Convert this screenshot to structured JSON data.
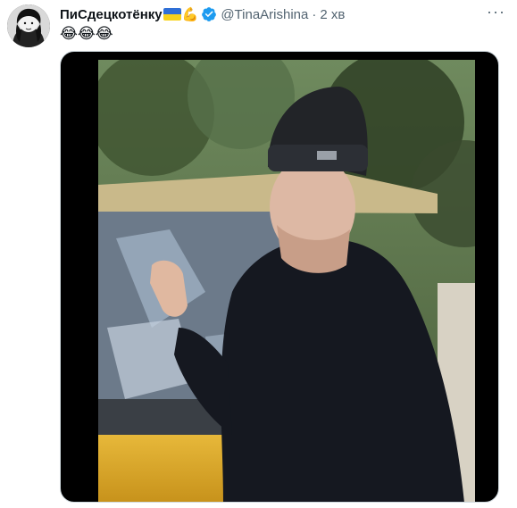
{
  "tweet": {
    "display_name": "ПиСдецкотёнку",
    "flag_emoji": "🇺🇦",
    "arm_emoji": "💪",
    "handle": "@TinaArishina",
    "separator": "·",
    "time": "2 хв",
    "text": "😂😂😂",
    "more_label": "···"
  },
  "icons": {
    "avatar": "avatar-image",
    "verified": "verified-badge-icon",
    "more": "more-options-icon",
    "media": "video-thumbnail"
  },
  "colors": {
    "verified_blue": "#1d9bf0",
    "name_text": "#0f1419",
    "secondary_text": "#536471"
  }
}
